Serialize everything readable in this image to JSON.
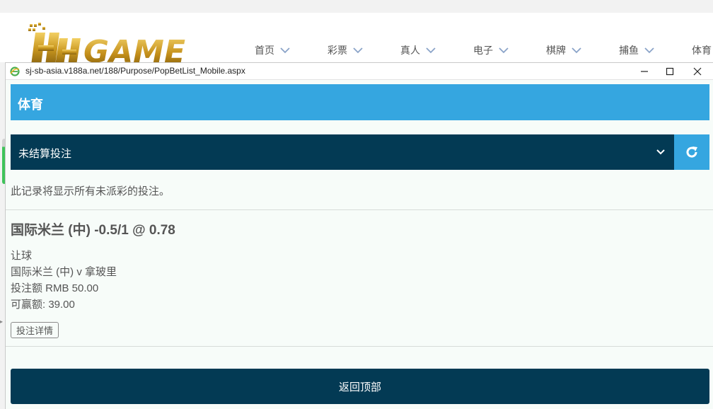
{
  "site": {
    "logo_text": "HH GAME",
    "nav": [
      {
        "label": "首页"
      },
      {
        "label": "彩票"
      },
      {
        "label": "真人"
      },
      {
        "label": "电子"
      },
      {
        "label": "棋牌"
      },
      {
        "label": "捕鱼"
      },
      {
        "label": "体育"
      }
    ]
  },
  "popup": {
    "url": "sj-sb-asia.v188a.net/188/Purpose/PopBetList_Mobile.aspx",
    "sport_title": "体育",
    "filter_selected": "未结算投注",
    "note": "此记录将显示所有未派彩的投注。",
    "bet": {
      "title": "国际米兰 (中) -0.5/1 @ 0.78",
      "market": "让球",
      "match": "国际米兰 (中) v 拿玻里",
      "stake": "投注额 RMB 50.00",
      "win": "可赢额: 39.00",
      "detail_label": "投注详情"
    },
    "back_to_top": "返回顶部"
  },
  "colors": {
    "sport_bar": "#35a6e0",
    "dark_navy": "#033a54",
    "logo_gold": "#c9971f"
  }
}
